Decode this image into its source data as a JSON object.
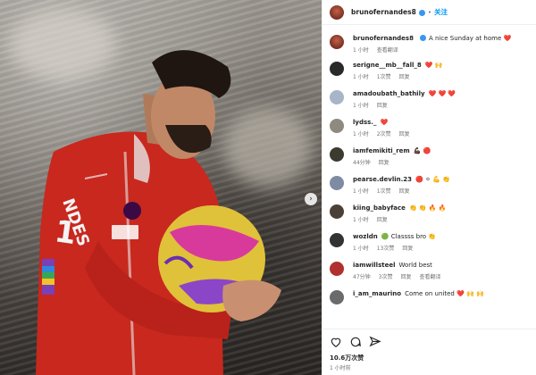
{
  "header": {
    "username": "brunofernandes8",
    "follow_label": "关注",
    "separator": "•"
  },
  "caption": {
    "username": "brunofernandes8",
    "text": "A nice Sunday at home ❤️",
    "time": "1 小时",
    "translate": "查看翻译"
  },
  "comments": [
    {
      "username": "serigne__mb__fall_8",
      "text": "❤️ 🙌",
      "time": "1 小时",
      "likes": "1次赞",
      "reply": "回复",
      "avatar_color": "#2a2a2a"
    },
    {
      "username": "amadoubath_bathily",
      "text": "❤️ ❤️ ❤️",
      "time": "1 小时",
      "likes": "",
      "reply": "回复",
      "avatar_color": "#a7b5c9"
    },
    {
      "username": "lydss._",
      "text": "❤️",
      "time": "1 小时",
      "likes": "2次赞",
      "reply": "回复",
      "avatar_color": "#8f8a7f"
    },
    {
      "username": "iamfemikiti_rem",
      "text": "💪🏿 🔴",
      "time": "44分钟",
      "likes": "",
      "reply": "回复",
      "avatar_color": "#3b3b2f"
    },
    {
      "username": "pearse.devlin.23",
      "text": "🔴 ⚪ 💪 👏",
      "time": "1 小时",
      "likes": "1次赞",
      "reply": "回复",
      "avatar_color": "#7d8ca3"
    },
    {
      "username": "kiing_babyface",
      "text": "👏 👏 🔥 🔥",
      "time": "1 小时",
      "likes": "",
      "reply": "回复",
      "avatar_color": "#4a4038"
    },
    {
      "username": "wozldn",
      "text": "🟢 Classss bro 👏",
      "time": "1 小时",
      "likes": "13次赞",
      "reply": "回复",
      "avatar_color": "#333333"
    },
    {
      "username": "iamwillsteel",
      "text": "World best",
      "time": "47分钟",
      "likes": "3次赞",
      "reply": "回复",
      "translate": "查看翻译",
      "avatar_color": "#b03030"
    },
    {
      "username": "i_am_maurino",
      "text": "Come on united ❤️ 🙌 🙌",
      "time": "",
      "likes": "",
      "reply": "",
      "avatar_color": "#6b6b6b"
    }
  ],
  "footer": {
    "likes": "10.6万次赞",
    "time": "1 小时前",
    "icons": [
      "heart-icon",
      "comment-icon",
      "share-icon"
    ]
  }
}
